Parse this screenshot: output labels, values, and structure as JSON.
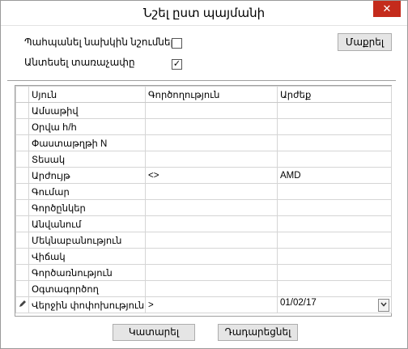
{
  "window": {
    "title": "Նշել ըստ պայմանի",
    "close_icon": "close-icon",
    "accent": "#c42b1c"
  },
  "options": {
    "keep_selection_label": "Պահպանել նախկին նշումները",
    "keep_selection_checked": false,
    "ignore_case_label": "Անտեսել տառաչափը",
    "ignore_case_checked": true,
    "check_mark": "✓"
  },
  "clear_button_label": "Մաքրել",
  "grid": {
    "headers": [
      "Սյուն",
      "Գործողություն",
      "Արժեք"
    ],
    "rows": [
      {
        "column": "Ամսաթիվ",
        "operation": "",
        "value": ""
      },
      {
        "column": "Օրվա հ/հ",
        "operation": "",
        "value": ""
      },
      {
        "column": "Փաստաթղթի N",
        "operation": "",
        "value": ""
      },
      {
        "column": "Տեսակ",
        "operation": "",
        "value": ""
      },
      {
        "column": "Արժույթ",
        "operation": "<>",
        "value": "AMD"
      },
      {
        "column": "Գումար",
        "operation": "",
        "value": ""
      },
      {
        "column": "Գործընկեր",
        "operation": "",
        "value": ""
      },
      {
        "column": "Անվանում",
        "operation": "",
        "value": ""
      },
      {
        "column": "Մեկնաբանություն",
        "operation": "",
        "value": ""
      },
      {
        "column": "Վիճակ",
        "operation": "",
        "value": ""
      },
      {
        "column": "Գործառնություն",
        "operation": "",
        "value": ""
      },
      {
        "column": "Օգտագործող",
        "operation": "",
        "value": ""
      },
      {
        "column": "Վերջին փոփոխություն",
        "operation": ">",
        "value": "01/02/17",
        "editing": true,
        "row_icon": "pencil-icon",
        "dropdown_icon": "chevron-down-icon"
      }
    ]
  },
  "footer": {
    "ok_label": "Կատարել",
    "cancel_label": "Դադարեցնել"
  }
}
